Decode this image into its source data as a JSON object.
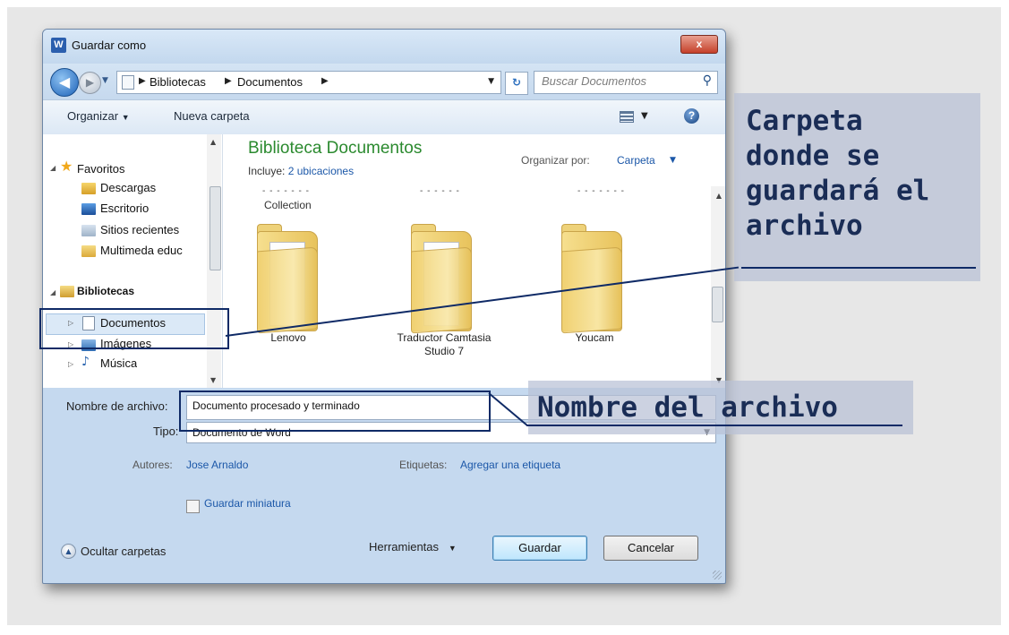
{
  "window": {
    "title": "Guardar como",
    "app_icon": "W",
    "close": "x"
  },
  "address": {
    "crumbs": [
      "Bibliotecas",
      "Documentos"
    ],
    "search_placeholder": "Buscar Documentos"
  },
  "toolbar": {
    "organize": "Organizar",
    "new_folder": "Nueva carpeta"
  },
  "nav": {
    "favorites": "Favoritos",
    "favorites_items": [
      "Descargas",
      "Escritorio",
      "Sitios recientes",
      "Multimeda educ"
    ],
    "libraries": "Bibliotecas",
    "libraries_items": [
      "Documentos",
      "Imágenes",
      "Música"
    ]
  },
  "library": {
    "title": "Biblioteca Documentos",
    "includes_label": "Incluye:",
    "includes_link": "2 ubicaciones",
    "arrange_label": "Organizar por:",
    "arrange_value": "Carpeta",
    "partial_label": "Collection",
    "folders": [
      {
        "name": "Lenovo"
      },
      {
        "name": "Traductor Camtasia Studio 7"
      },
      {
        "name": "Youcam"
      }
    ]
  },
  "form": {
    "filename_label": "Nombre de archivo:",
    "filename_value": "Documento procesado y terminado",
    "type_label": "Tipo:",
    "type_value": "Documento de Word",
    "authors_label": "Autores:",
    "authors_value": "Jose Arnaldo",
    "tags_label": "Etiquetas:",
    "tags_value": "Agregar una etiqueta",
    "thumbnail_label": "Guardar miniatura"
  },
  "footer": {
    "hide_folders": "Ocultar carpetas",
    "tools": "Herramientas",
    "save": "Guardar",
    "cancel": "Cancelar"
  },
  "annotations": {
    "folder_callout": "Carpeta\ndonde se\nguardará el\narchivo",
    "filename_callout": "Nombre del archivo"
  },
  "colors": {
    "annotation": "#0f2a66",
    "library_title": "#2b8a2f",
    "link": "#1b57a8"
  }
}
